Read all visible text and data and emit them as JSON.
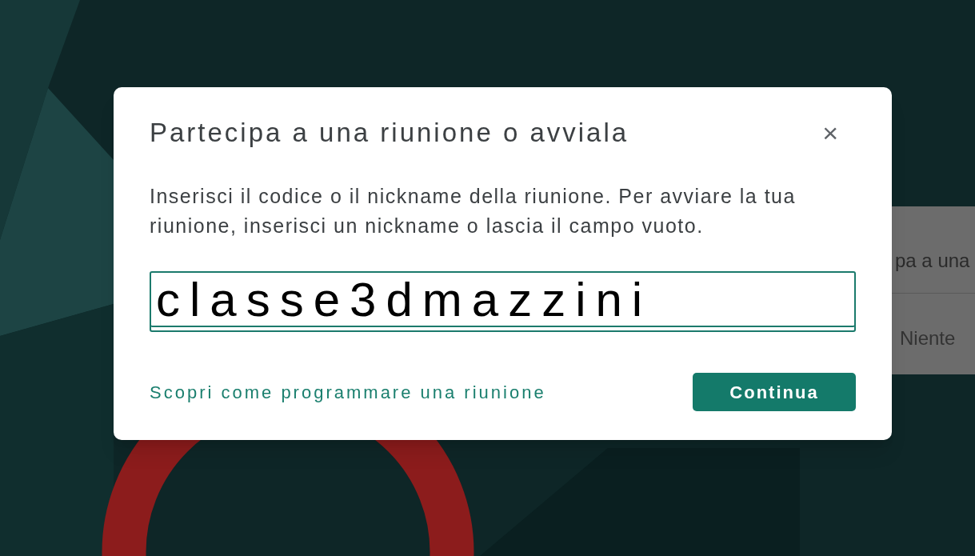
{
  "background_card": {
    "title": "pa a una",
    "item": "Niente"
  },
  "dialog": {
    "title": "Partecipa a una riunione o avviala",
    "close": "×",
    "description": "Inserisci il codice o il nickname della riunione. Per avviare la tua riunione, inserisci un nickname o lascia il campo vuoto.",
    "field": {
      "value": "classe3dmazzini"
    },
    "link": "Scopri come programmare una riunione",
    "button": "Continua"
  }
}
